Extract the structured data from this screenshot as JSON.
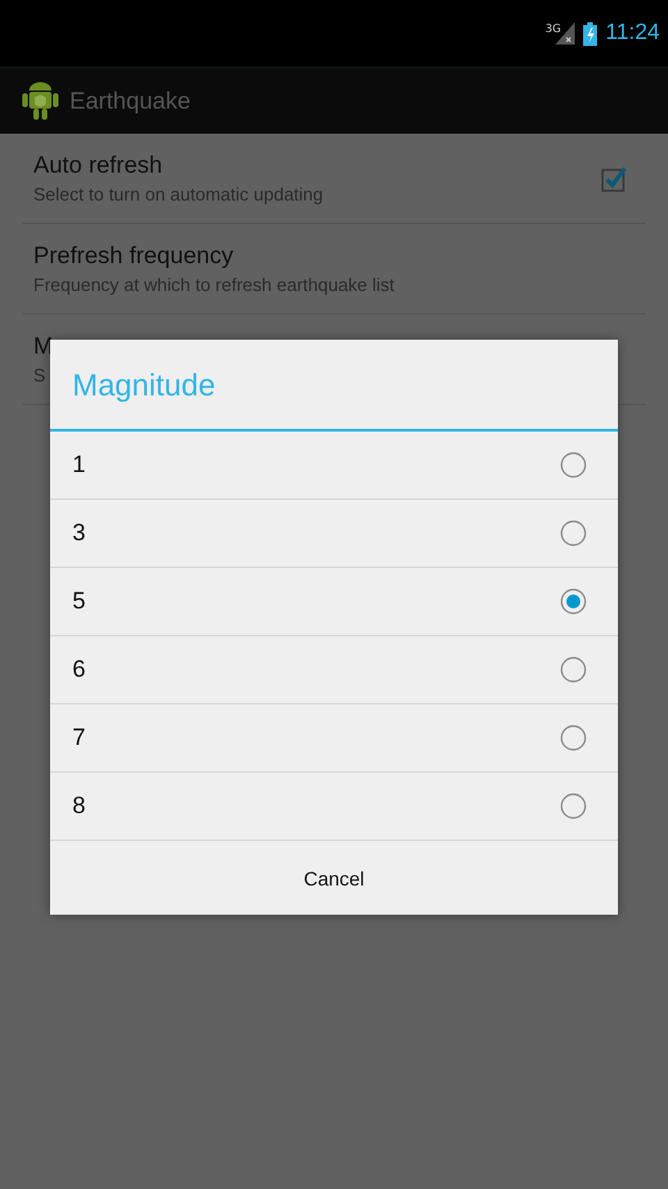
{
  "status_bar": {
    "network": "3G",
    "time": "11:24"
  },
  "action_bar": {
    "title": "Earthquake"
  },
  "preferences": [
    {
      "kind": "checkbox",
      "title": "Auto refresh",
      "summary": "Select to turn on automatic updating",
      "checked": true
    },
    {
      "kind": "list",
      "title": "Prefresh frequency",
      "summary": "Frequency at which to refresh earthquake list"
    },
    {
      "kind": "list",
      "title": "M",
      "summary": "S"
    }
  ],
  "dialog": {
    "title": "Magnitude",
    "options": [
      {
        "label": "1",
        "selected": false
      },
      {
        "label": "3",
        "selected": false
      },
      {
        "label": "5",
        "selected": true
      },
      {
        "label": "6",
        "selected": false
      },
      {
        "label": "7",
        "selected": false
      },
      {
        "label": "8",
        "selected": false
      }
    ],
    "buttons": [
      "Cancel"
    ]
  }
}
